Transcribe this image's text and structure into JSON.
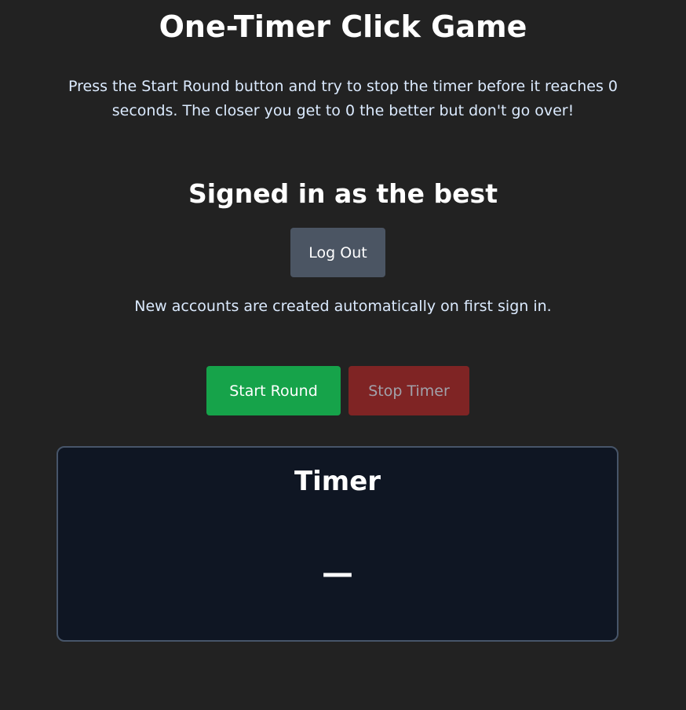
{
  "header": {
    "title": "One-Timer Click Game",
    "instructions": "Press the Start Round button and try to stop the timer before it reaches 0 seconds. The closer you get to 0 the better but don't go over!"
  },
  "account": {
    "signed_in_text": "Signed in as the best",
    "logout_label": "Log Out",
    "note": "New accounts are created automatically on first sign in."
  },
  "controls": {
    "start_label": "Start Round",
    "stop_label": "Stop Timer",
    "start_color": "#16a34a",
    "stop_color": "#7f2424"
  },
  "timer": {
    "heading": "Timer",
    "value": "—"
  }
}
